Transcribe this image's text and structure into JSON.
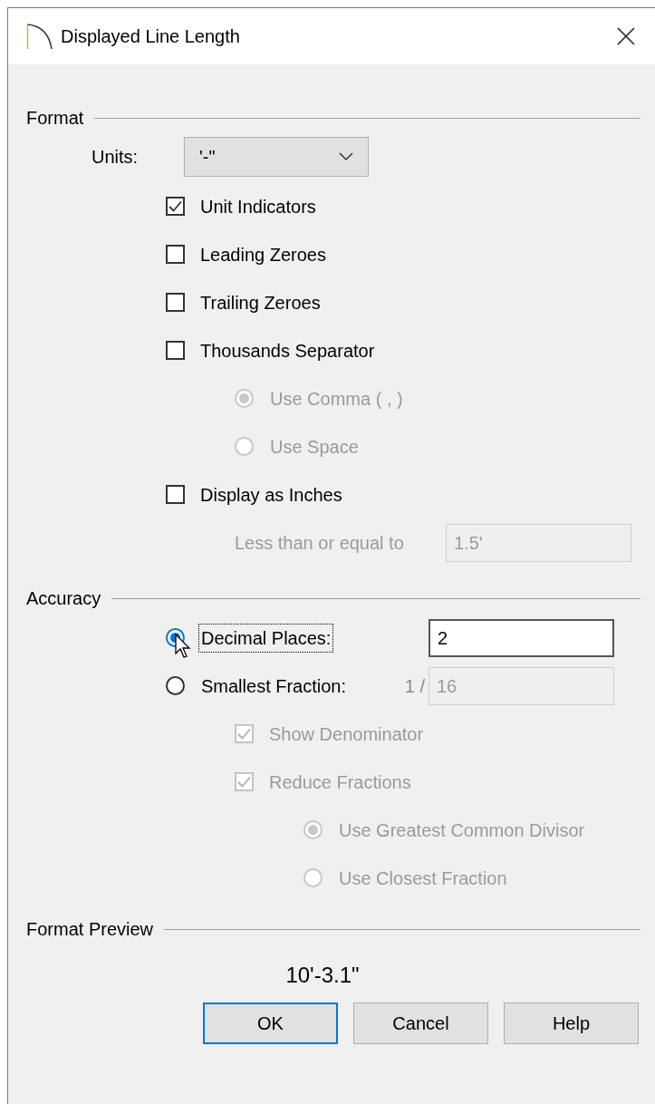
{
  "window": {
    "title": "Displayed Line Length"
  },
  "format": {
    "heading": "Format",
    "units": {
      "label": "Units:",
      "value": "'-\""
    },
    "options": [
      {
        "kind": "checkbox",
        "label": "Unit Indicators",
        "checked": true,
        "disabled": false
      },
      {
        "kind": "checkbox",
        "label": "Leading Zeroes",
        "checked": false,
        "disabled": false
      },
      {
        "kind": "checkbox",
        "label": "Trailing Zeroes",
        "checked": false,
        "disabled": false
      },
      {
        "kind": "checkbox",
        "label": "Thousands Separator",
        "checked": false,
        "disabled": false,
        "children": [
          {
            "kind": "radio",
            "label": "Use Comma ( , )",
            "selected": true,
            "disabled": true
          },
          {
            "kind": "radio",
            "label": "Use Space",
            "selected": false,
            "disabled": true
          }
        ]
      },
      {
        "kind": "checkbox",
        "label": "Display as Inches",
        "checked": false,
        "disabled": false,
        "children": [
          {
            "kind": "field",
            "label": "Less than or equal to",
            "value": "1.5'",
            "disabled": true
          }
        ]
      }
    ]
  },
  "accuracy": {
    "heading": "Accuracy",
    "options": [
      {
        "kind": "radio",
        "label": "Decimal Places:",
        "selected": true,
        "disabled": false,
        "focused": true,
        "field": {
          "value": "2",
          "disabled": false
        }
      },
      {
        "kind": "radio",
        "label": "Smallest Fraction:",
        "selected": false,
        "disabled": false,
        "focused": false,
        "prefix": "1 /",
        "field": {
          "value": "16",
          "disabled": true
        },
        "children": [
          {
            "kind": "checkbox",
            "label": "Show Denominator",
            "checked": true,
            "disabled": true
          },
          {
            "kind": "checkbox",
            "label": "Reduce Fractions",
            "checked": true,
            "disabled": true,
            "children": [
              {
                "kind": "radio",
                "label": "Use Greatest Common Divisor",
                "selected": true,
                "disabled": true
              },
              {
                "kind": "radio",
                "label": "Use Closest Fraction",
                "selected": false,
                "disabled": true
              }
            ]
          }
        ]
      }
    ]
  },
  "preview": {
    "heading": "Format Preview",
    "value": "10'-3.1\""
  },
  "buttons": [
    {
      "label": "OK",
      "default": true
    },
    {
      "label": "Cancel",
      "default": false
    },
    {
      "label": "Help",
      "default": false
    }
  ]
}
